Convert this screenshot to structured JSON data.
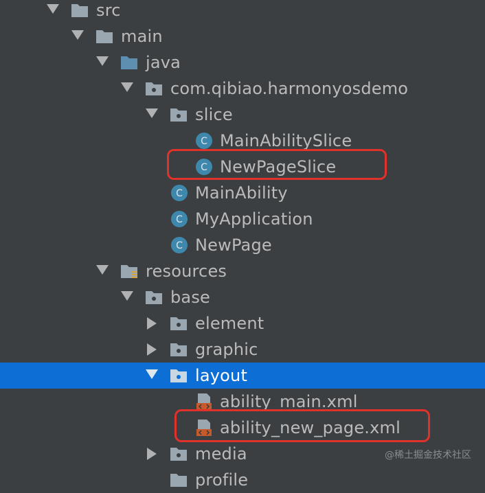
{
  "tree": {
    "src": "src",
    "main": "main",
    "java": "java",
    "package": "com.qibiao.harmonyosdemo",
    "slice": "slice",
    "main_ability_slice": "MainAbilitySlice",
    "new_page_slice": "NewPageSlice",
    "main_ability": "MainAbility",
    "my_application": "MyApplication",
    "new_page": "NewPage",
    "resources": "resources",
    "base": "base",
    "element": "element",
    "graphic": "graphic",
    "layout": "layout",
    "ability_main": "ability_main.xml",
    "ability_new_page": "ability_new_page.xml",
    "media": "media",
    "profile": "profile"
  },
  "class_icon_letter": "C",
  "watermark": "@稀土掘金技术社区",
  "colors": {
    "background": "#3c3f41",
    "selection": "#0d6fd6",
    "highlight_border": "#e0312b",
    "folder": "#9aa7b0",
    "java_folder": "#5f8fb0",
    "class_icon": "#3f88ad",
    "xml_icon": "#c75a2a"
  }
}
